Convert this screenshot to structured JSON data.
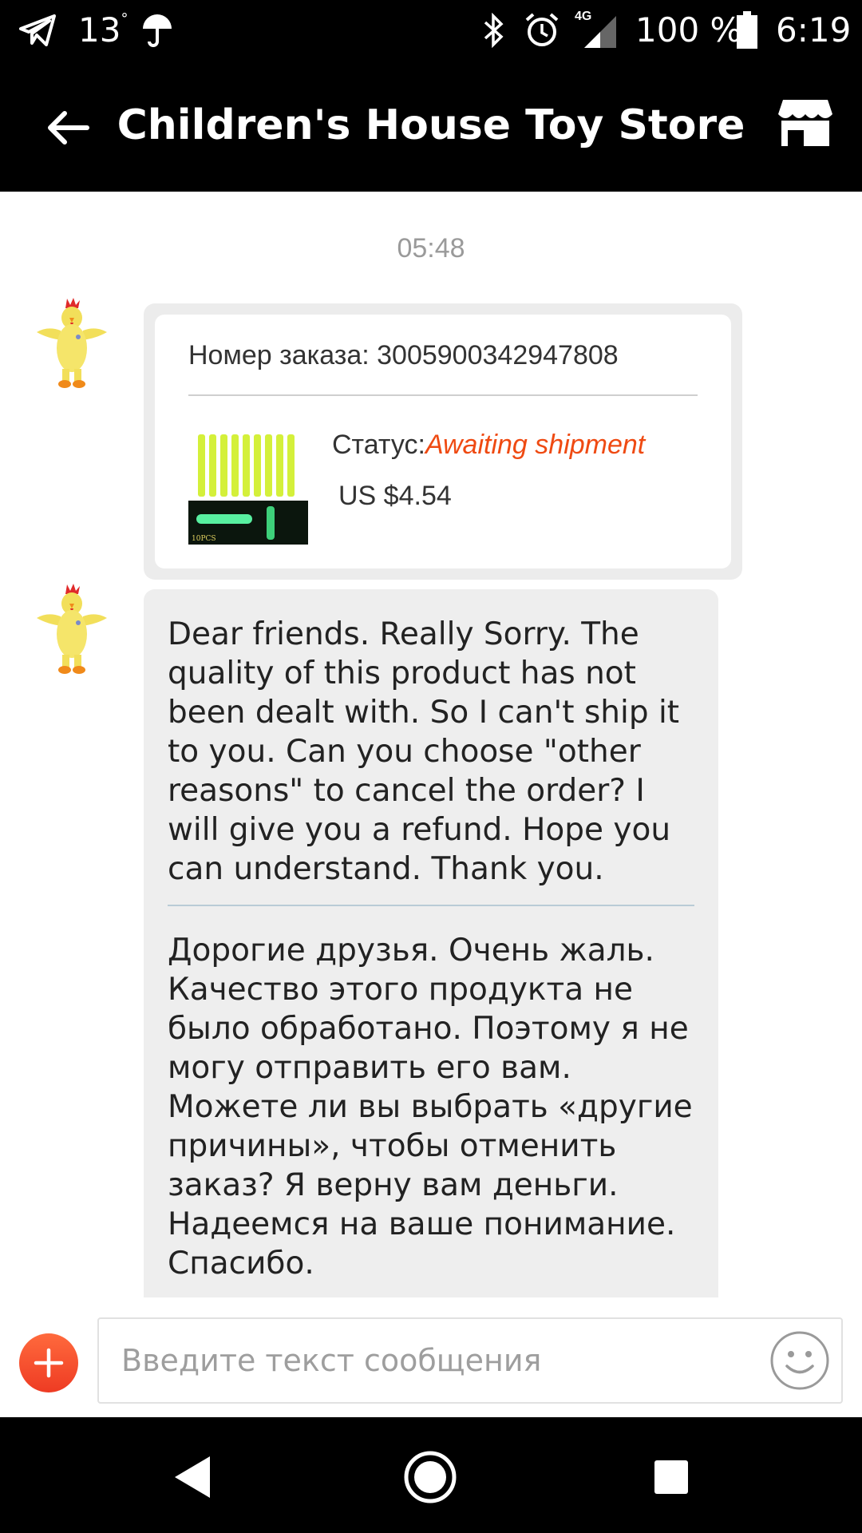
{
  "status_bar": {
    "temperature": "13",
    "temperature_unit": "°",
    "network": "4G",
    "battery": "100 %",
    "time": "6:19",
    "icons": [
      "telegram-icon",
      "umbrella-icon",
      "bluetooth-icon",
      "alarm-icon",
      "signal-icon",
      "battery-icon"
    ]
  },
  "header": {
    "title": "Children's House Toy Store",
    "back_icon": "arrow-left-icon",
    "store_icon": "store-icon"
  },
  "chat": {
    "timestamp": "05:48",
    "order_card": {
      "order_label": "Номер заказа: 3005900342947808",
      "status_label": "Статус:",
      "status_value": "Awaiting shipment",
      "price": "US $4.54",
      "thumb_caption": "10PCS"
    },
    "message": {
      "text_en": "Dear friends. Really Sorry. The quality of this product has not been dealt with. So I can't ship it to you. Can you choose \"other reasons\" to cancel the order? I will give you a refund. Hope you can understand. Thank you.",
      "text_ru": "Дорогие друзья. Очень жаль. Качество этого продукта не было обработано. Поэтому я не могу отправить его вам. Можете ли вы выбрать «другие причины», чтобы отменить заказ? Я верну вам деньги. Надеемся на ваше понимание. Спасибо."
    }
  },
  "composer": {
    "placeholder": "Введите текст сообщения",
    "value": ""
  },
  "colors": {
    "accent": "#ef4a12",
    "bar": "#000000",
    "bubble": "#eeeeee"
  }
}
